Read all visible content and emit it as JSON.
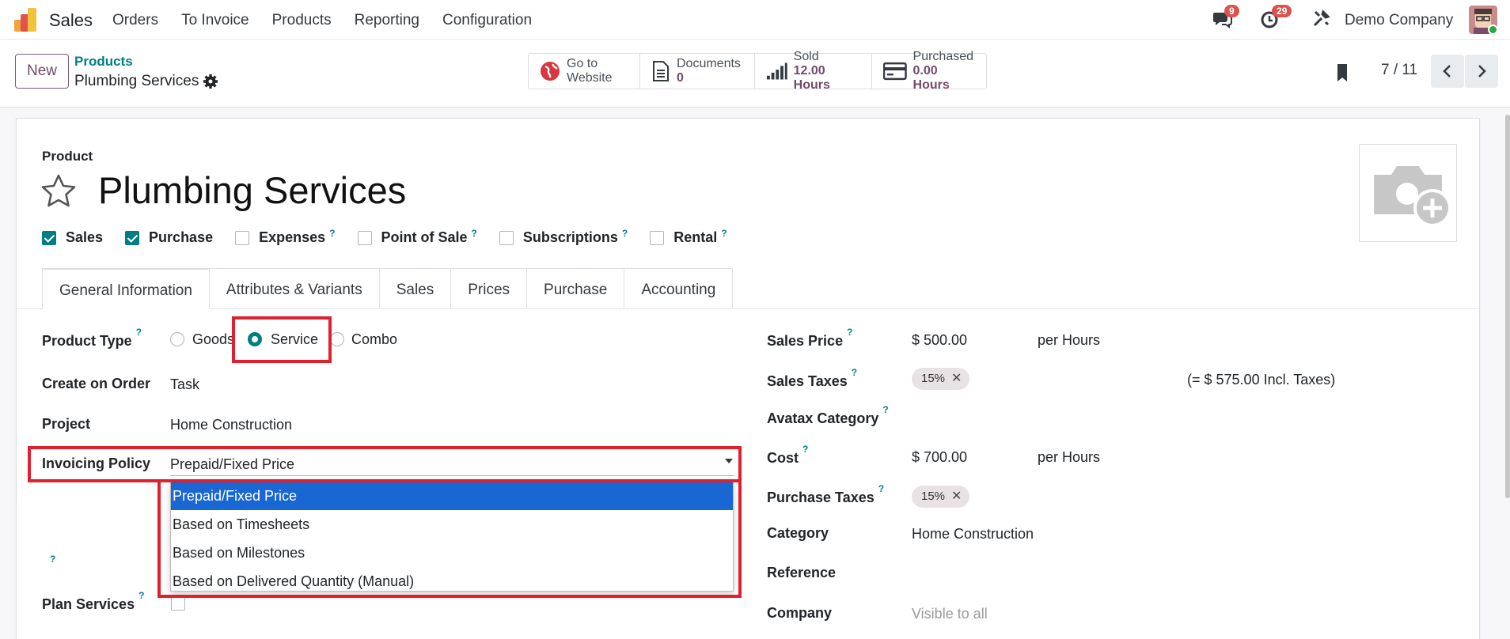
{
  "navbar": {
    "app_name": "Sales",
    "menu": [
      "Orders",
      "To Invoice",
      "Products",
      "Reporting",
      "Configuration"
    ],
    "messages_badge": "9",
    "activities_badge": "29",
    "company": "Demo Company"
  },
  "control": {
    "new_label": "New",
    "breadcrumb_parent": "Products",
    "breadcrumb_current": "Plumbing Services",
    "smart_buttons": [
      {
        "line1": "Go to",
        "line2": "Website",
        "icon": "globe-icon"
      },
      {
        "line1": "Documents",
        "line2": "0",
        "icon": "document-icon"
      },
      {
        "line1": "Sold",
        "line2": "12.00 Hours",
        "icon": "signal-icon"
      },
      {
        "line1": "Purchased",
        "line2": "0.00 Hours",
        "icon": "credit-card-icon"
      }
    ],
    "pager": "7 / 11"
  },
  "form": {
    "product_label": "Product",
    "product_name": "Plumbing Services",
    "checkboxes": [
      {
        "label": "Sales",
        "checked": true,
        "help": ""
      },
      {
        "label": "Purchase",
        "checked": true,
        "help": ""
      },
      {
        "label": "Expenses",
        "checked": false,
        "help": "?"
      },
      {
        "label": "Point of Sale",
        "checked": false,
        "help": "?"
      },
      {
        "label": "Subscriptions",
        "checked": false,
        "help": "?"
      },
      {
        "label": "Rental",
        "checked": false,
        "help": "?"
      }
    ],
    "tabs": [
      "General Information",
      "Attributes & Variants",
      "Sales",
      "Prices",
      "Purchase",
      "Accounting"
    ],
    "left": {
      "product_type_label": "Product Type",
      "type_options": [
        "Goods",
        "Service",
        "Combo"
      ],
      "selected_type": "Service",
      "create_on_order_label": "Create on Order",
      "create_on_order": "Task",
      "project_label": "Project",
      "project": "Home Construction",
      "invoicing_policy_label": "Invoicing Policy",
      "invoicing_policy": "Prepaid/Fixed Price",
      "invoicing_options": [
        "Prepaid/Fixed Price",
        "Based on Timesheets",
        "Based on Milestones",
        "Based on Delivered Quantity (Manual)"
      ],
      "plan_services_label": "Plan Services",
      "help": "?"
    },
    "right": {
      "sales_price_label": "Sales Price",
      "sales_price": "$ 500.00",
      "sales_price_uom": "per Hours",
      "sales_taxes_label": "Sales Taxes",
      "sales_tax_tag": "15%",
      "incl_taxes": "(= $ 575.00 Incl. Taxes)",
      "avatax_label": "Avatax Category",
      "cost_label": "Cost",
      "cost": "$ 700.00",
      "cost_uom": "per Hours",
      "purchase_taxes_label": "Purchase Taxes",
      "purchase_tax_tag": "15%",
      "category_label": "Category",
      "category": "Home Construction",
      "reference_label": "Reference",
      "company_label": "Company",
      "company_placeholder": "Visible to all"
    }
  },
  "colors": {
    "brand": "#714b67",
    "accent": "#017e84",
    "highlight": "#e0202e",
    "selected_option": "#1967d2"
  }
}
